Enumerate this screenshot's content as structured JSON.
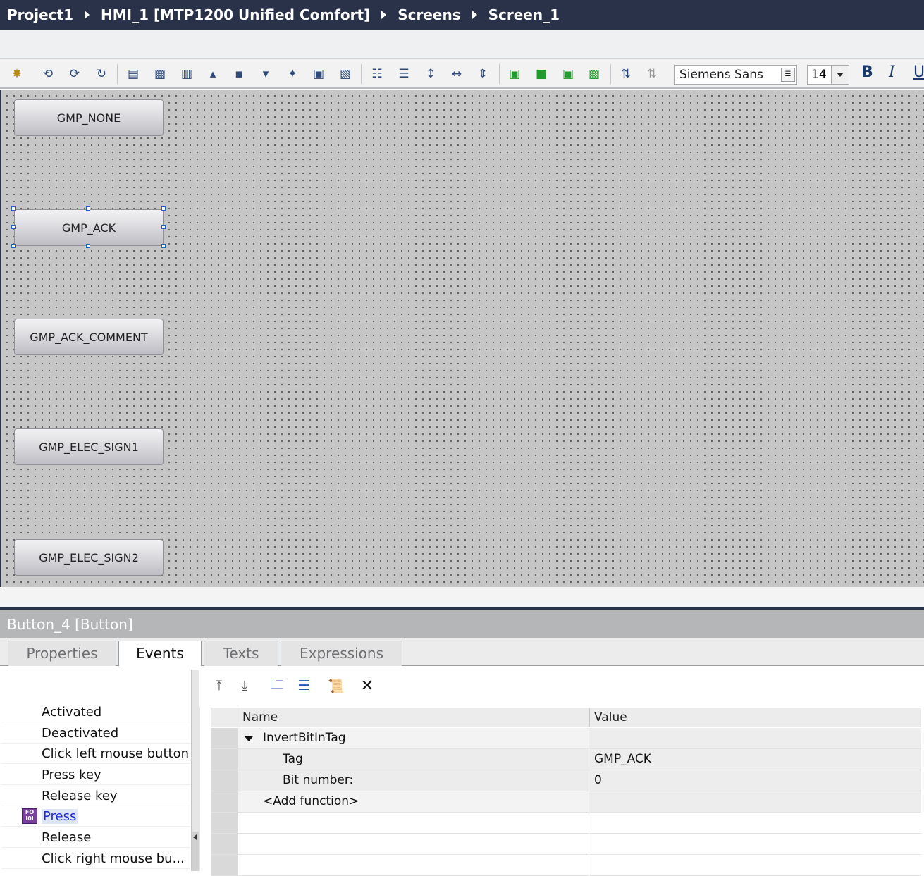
{
  "breadcrumb": [
    "Project1",
    "HMI_1 [MTP1200 Unified Comfort]",
    "Screens",
    "Screen_1"
  ],
  "toolbar": {
    "font_name": "Siemens Sans",
    "font_size": "14",
    "bold": "B",
    "italic": "I",
    "underline": "U"
  },
  "canvas": {
    "buttons": [
      "GMP_NONE",
      "GMP_ACK",
      "GMP_ACK_COMMENT",
      "GMP_ELEC_SIGN1",
      "GMP_ELEC_SIGN2"
    ],
    "selected": "GMP_ACK"
  },
  "inspector": {
    "title": "Button_4 [Button]",
    "tabs": [
      "Properties",
      "Events",
      "Texts",
      "Expressions"
    ],
    "active_tab": "Events",
    "events": [
      "Activated",
      "Deactivated",
      "Click left mouse button",
      "Press key",
      "Release key",
      "Press",
      "Release",
      "Click right mouse bu..."
    ],
    "selected_event": "Press",
    "grid": {
      "headers": {
        "name": "Name",
        "value": "Value"
      },
      "rows": [
        {
          "name": "InvertBitInTag",
          "value": ""
        },
        {
          "name": "Tag",
          "value": "GMP_ACK"
        },
        {
          "name": "Bit number:",
          "value": "0"
        },
        {
          "name": "<Add function>",
          "value": ""
        }
      ]
    }
  }
}
